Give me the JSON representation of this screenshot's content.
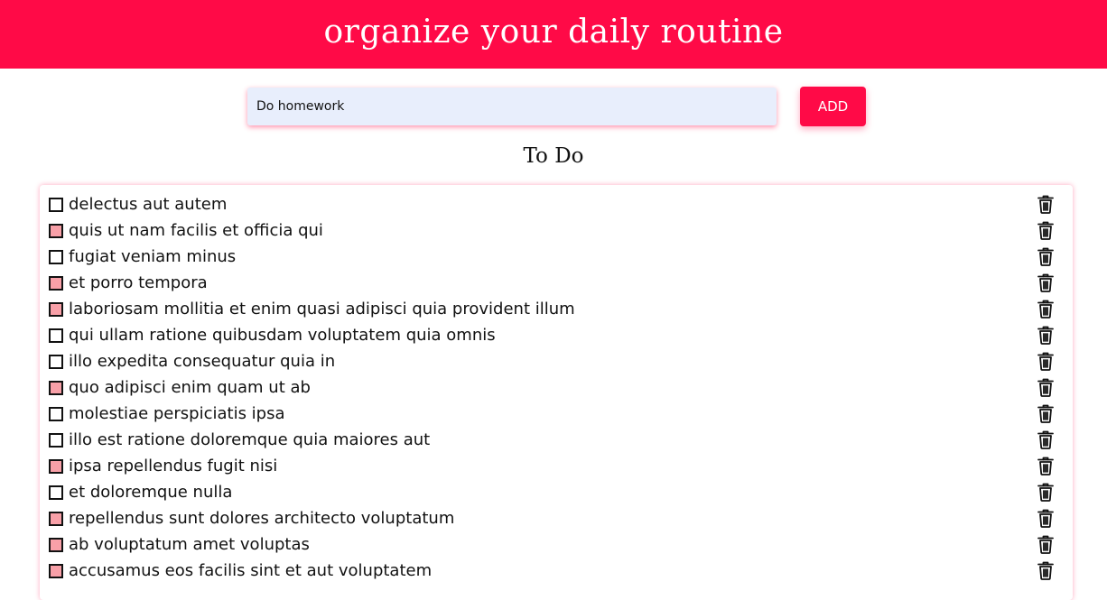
{
  "header": {
    "title": "organize your daily routine"
  },
  "form": {
    "input_value": "Do homework",
    "add_label": "ADD"
  },
  "section": {
    "title": "To Do"
  },
  "icons": {
    "delete": "trash-icon"
  },
  "colors": {
    "accent": "#ff0a47",
    "input_bg": "#e8eefc",
    "checked_box": "#f8a0a8"
  },
  "todos": [
    {
      "text": "delectus aut autem",
      "checked": false
    },
    {
      "text": "quis ut nam facilis et officia qui",
      "checked": true
    },
    {
      "text": "fugiat veniam minus",
      "checked": false
    },
    {
      "text": "et porro tempora",
      "checked": true
    },
    {
      "text": "laboriosam mollitia et enim quasi adipisci quia provident illum",
      "checked": true
    },
    {
      "text": "qui ullam ratione quibusdam voluptatem quia omnis",
      "checked": false
    },
    {
      "text": "illo expedita consequatur quia in",
      "checked": false
    },
    {
      "text": "quo adipisci enim quam ut ab",
      "checked": true
    },
    {
      "text": "molestiae perspiciatis ipsa",
      "checked": false
    },
    {
      "text": "illo est ratione doloremque quia maiores aut",
      "checked": false
    },
    {
      "text": "ipsa repellendus fugit nisi",
      "checked": true
    },
    {
      "text": "et doloremque nulla",
      "checked": false
    },
    {
      "text": "repellendus sunt dolores architecto voluptatum",
      "checked": true
    },
    {
      "text": "ab voluptatum amet voluptas",
      "checked": true
    },
    {
      "text": "accusamus eos facilis sint et aut voluptatem",
      "checked": true
    }
  ]
}
